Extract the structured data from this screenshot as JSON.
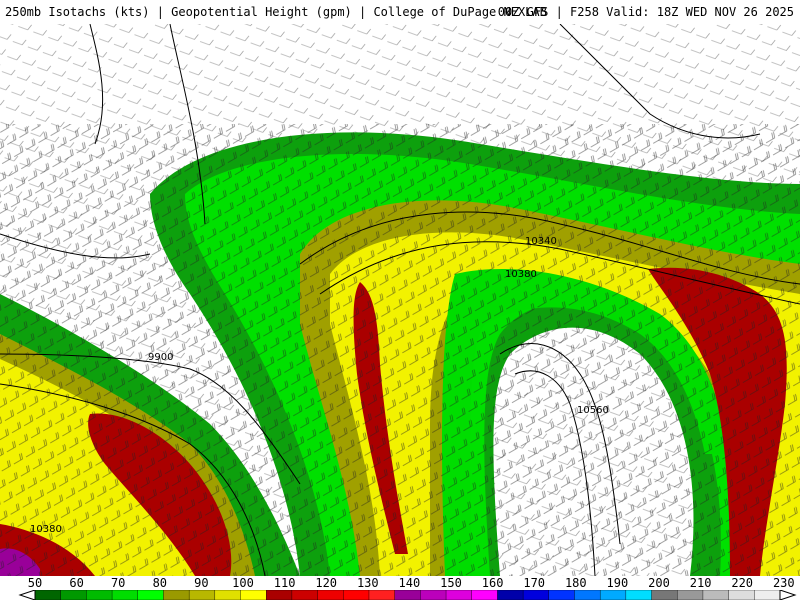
{
  "header": {
    "left": "250mb Isotachs (kts) | Geopotential Height (gpm) | College of DuPage NEXLAB",
    "right": "00Z GFS | F258 Valid: 18Z WED NOV 26 2025"
  },
  "contour_labels": [
    "9900",
    "10340",
    "10380",
    "10560",
    "10380"
  ],
  "scale": {
    "ticks": [
      "50",
      "60",
      "70",
      "80",
      "90",
      "100",
      "110",
      "120",
      "130",
      "140",
      "150",
      "160",
      "170",
      "180",
      "190",
      "200",
      "210",
      "220",
      "230"
    ],
    "colors": [
      "#006600",
      "#009900",
      "#00bb00",
      "#00dd00",
      "#00ff00",
      "#9a9a00",
      "#b8b800",
      "#e0e000",
      "#ffff00",
      "#aa0000",
      "#cc0000",
      "#ee0000",
      "#ff0000",
      "#ff2020",
      "#990099",
      "#bb00bb",
      "#dd00dd",
      "#ff00ff",
      "#0000aa",
      "#0000dd",
      "#0033ff",
      "#0077ff",
      "#00aaff",
      "#00ddff",
      "#777777",
      "#999999",
      "#bbbbbb",
      "#dddddd",
      "#eeeeee"
    ]
  },
  "colors": {
    "band_outer": "#0da00d",
    "band_green": "#00e000",
    "band_olive": "#a0a000",
    "band_yellow": "#f2f200",
    "band_core": "#aa0000"
  }
}
